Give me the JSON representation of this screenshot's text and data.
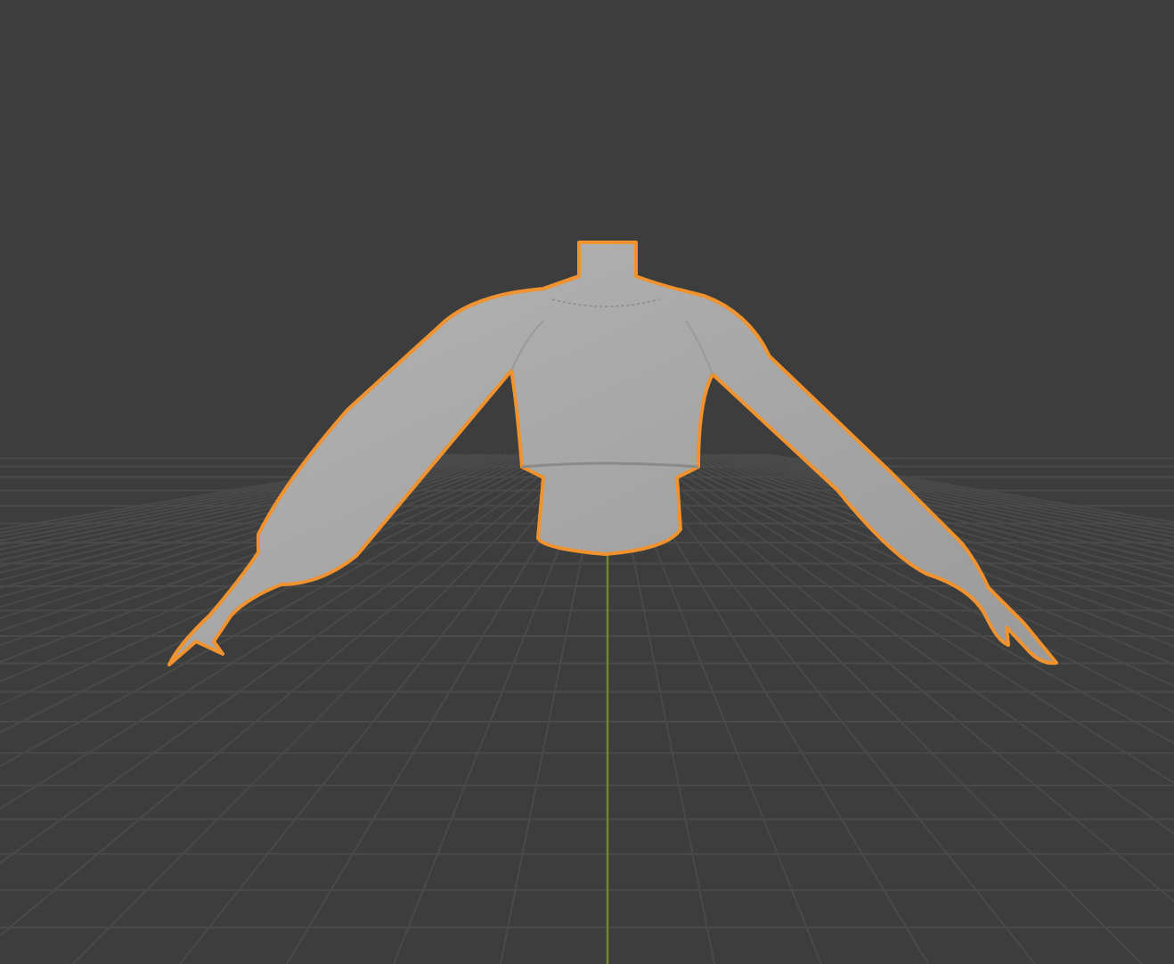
{
  "viewport": {
    "kind": "viewport",
    "object": {
      "kind": "sweater",
      "selected": true
    }
  }
}
